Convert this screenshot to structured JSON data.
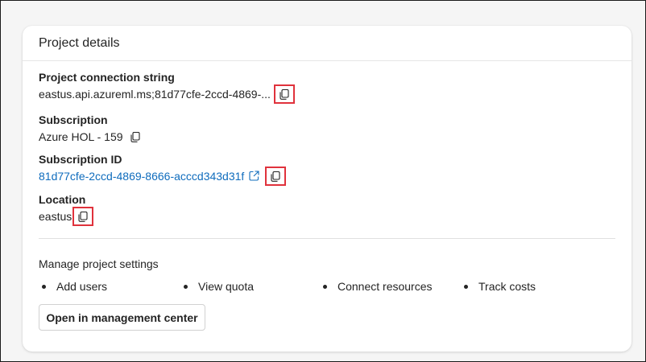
{
  "card": {
    "title": "Project details"
  },
  "connection": {
    "label": "Project connection string",
    "value": "eastus.api.azureml.ms;81d77cfe-2ccd-4869-..."
  },
  "subscription": {
    "label": "Subscription",
    "value": "Azure HOL - 159"
  },
  "subscription_id": {
    "label": "Subscription ID",
    "value": "81d77cfe-2ccd-4869-8666-acccd343d31f"
  },
  "location": {
    "label": "Location",
    "value": "eastus"
  },
  "manage": {
    "title": "Manage project settings",
    "items": [
      "Add users",
      "View quota",
      "Connect resources",
      "Track costs"
    ],
    "button_label": "Open in management center"
  },
  "colors": {
    "link": "#0f6cbd",
    "highlight": "#e0323c"
  },
  "icons": {
    "copy": "copy-icon",
    "external": "open-external-icon"
  }
}
